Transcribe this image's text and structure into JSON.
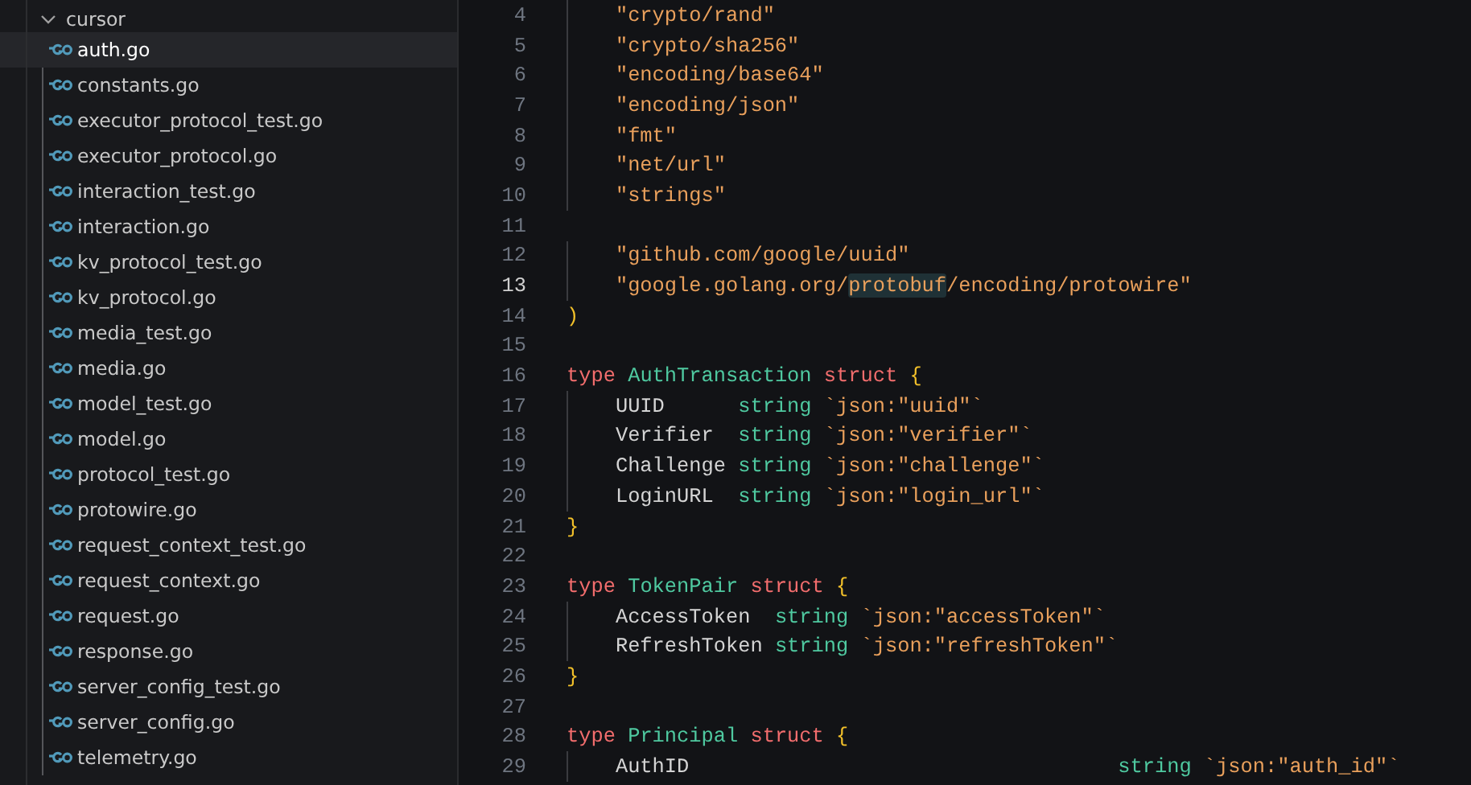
{
  "explorer": {
    "folder": {
      "name": "cursor",
      "expanded": true
    },
    "files": [
      {
        "name": "auth.go",
        "selected": true
      },
      {
        "name": "constants.go",
        "selected": false
      },
      {
        "name": "executor_protocol_test.go",
        "selected": false
      },
      {
        "name": "executor_protocol.go",
        "selected": false
      },
      {
        "name": "interaction_test.go",
        "selected": false
      },
      {
        "name": "interaction.go",
        "selected": false
      },
      {
        "name": "kv_protocol_test.go",
        "selected": false
      },
      {
        "name": "kv_protocol.go",
        "selected": false
      },
      {
        "name": "media_test.go",
        "selected": false
      },
      {
        "name": "media.go",
        "selected": false
      },
      {
        "name": "model_test.go",
        "selected": false
      },
      {
        "name": "model.go",
        "selected": false
      },
      {
        "name": "protocol_test.go",
        "selected": false
      },
      {
        "name": "protowire.go",
        "selected": false
      },
      {
        "name": "request_context_test.go",
        "selected": false
      },
      {
        "name": "request_context.go",
        "selected": false
      },
      {
        "name": "request.go",
        "selected": false
      },
      {
        "name": "response.go",
        "selected": false
      },
      {
        "name": "server_config_test.go",
        "selected": false
      },
      {
        "name": "server_config.go",
        "selected": false
      },
      {
        "name": "telemetry.go",
        "selected": false
      }
    ]
  },
  "editor": {
    "lines": [
      {
        "number": "4",
        "current": false,
        "tokens": [
          {
            "kind": "string",
            "text": "    \"crypto/rand\""
          }
        ]
      },
      {
        "number": "5",
        "current": false,
        "tokens": [
          {
            "kind": "string",
            "text": "    \"crypto/sha256\""
          }
        ]
      },
      {
        "number": "6",
        "current": false,
        "tokens": [
          {
            "kind": "string",
            "text": "    \"encoding/base64\""
          }
        ]
      },
      {
        "number": "7",
        "current": false,
        "tokens": [
          {
            "kind": "string",
            "text": "    \"encoding/json\""
          }
        ]
      },
      {
        "number": "8",
        "current": false,
        "tokens": [
          {
            "kind": "string",
            "text": "    \"fmt\""
          }
        ]
      },
      {
        "number": "9",
        "current": false,
        "tokens": [
          {
            "kind": "string",
            "text": "    \"net/url\""
          }
        ]
      },
      {
        "number": "10",
        "current": false,
        "tokens": [
          {
            "kind": "string",
            "text": "    \"strings\""
          }
        ]
      },
      {
        "number": "11",
        "current": false
      },
      {
        "number": "12",
        "current": false,
        "tokens": [
          {
            "kind": "string",
            "text": "    \"github.com/google/uuid\""
          }
        ]
      },
      {
        "number": "13",
        "current": true,
        "tokens": [
          {
            "kind": "string",
            "text": "    \"google.golang.org/"
          },
          {
            "kind": "string",
            "text": "protobuf",
            "highlighted": true
          },
          {
            "kind": "string",
            "text": "/encoding/protowire\""
          }
        ]
      },
      {
        "number": "14",
        "current": false,
        "tokens": [
          {
            "kind": "bracket",
            "text": ")"
          }
        ]
      },
      {
        "number": "15",
        "current": false
      },
      {
        "number": "16",
        "current": false,
        "tokens": [
          {
            "kind": "keyword",
            "text": "type "
          },
          {
            "kind": "type",
            "text": "AuthTransaction "
          },
          {
            "kind": "keyword",
            "text": "struct "
          },
          {
            "kind": "bracket",
            "text": "{"
          }
        ]
      },
      {
        "number": "17",
        "current": false,
        "tokens": [
          {
            "kind": "plain",
            "text": "    UUID      "
          },
          {
            "kind": "type",
            "text": "string "
          },
          {
            "kind": "string",
            "text": "`json:\"uuid\"`"
          }
        ]
      },
      {
        "number": "18",
        "current": false,
        "tokens": [
          {
            "kind": "plain",
            "text": "    Verifier  "
          },
          {
            "kind": "type",
            "text": "string "
          },
          {
            "kind": "string",
            "text": "`json:\"verifier\"`"
          }
        ]
      },
      {
        "number": "19",
        "current": false,
        "tokens": [
          {
            "kind": "plain",
            "text": "    Challenge "
          },
          {
            "kind": "type",
            "text": "string "
          },
          {
            "kind": "string",
            "text": "`json:\"challenge\"`"
          }
        ]
      },
      {
        "number": "20",
        "current": false,
        "tokens": [
          {
            "kind": "plain",
            "text": "    LoginURL  "
          },
          {
            "kind": "type",
            "text": "string "
          },
          {
            "kind": "string",
            "text": "`json:\"login_url\"`"
          }
        ]
      },
      {
        "number": "21",
        "current": false,
        "tokens": [
          {
            "kind": "bracket",
            "text": "}"
          }
        ]
      },
      {
        "number": "22",
        "current": false
      },
      {
        "number": "23",
        "current": false,
        "tokens": [
          {
            "kind": "keyword",
            "text": "type "
          },
          {
            "kind": "type",
            "text": "TokenPair "
          },
          {
            "kind": "keyword",
            "text": "struct "
          },
          {
            "kind": "bracket",
            "text": "{"
          }
        ]
      },
      {
        "number": "24",
        "current": false,
        "tokens": [
          {
            "kind": "plain",
            "text": "    AccessToken  "
          },
          {
            "kind": "type",
            "text": "string "
          },
          {
            "kind": "string",
            "text": "`json:\"accessToken\"`"
          }
        ]
      },
      {
        "number": "25",
        "current": false,
        "tokens": [
          {
            "kind": "plain",
            "text": "    RefreshToken "
          },
          {
            "kind": "type",
            "text": "string "
          },
          {
            "kind": "string",
            "text": "`json:\"refreshToken\"`"
          }
        ]
      },
      {
        "number": "26",
        "current": false,
        "tokens": [
          {
            "kind": "bracket",
            "text": "}"
          }
        ]
      },
      {
        "number": "27",
        "current": false
      },
      {
        "number": "28",
        "current": false,
        "tokens": [
          {
            "kind": "keyword",
            "text": "type "
          },
          {
            "kind": "type",
            "text": "Principal "
          },
          {
            "kind": "keyword",
            "text": "struct "
          },
          {
            "kind": "bracket",
            "text": "{"
          }
        ]
      },
      {
        "number": "29",
        "current": false,
        "tokens": [
          {
            "kind": "plain",
            "text": "    AuthID                                   "
          },
          {
            "kind": "type",
            "text": "string "
          },
          {
            "kind": "string",
            "text": "`json:\"auth_id\"`"
          }
        ]
      }
    ]
  }
}
